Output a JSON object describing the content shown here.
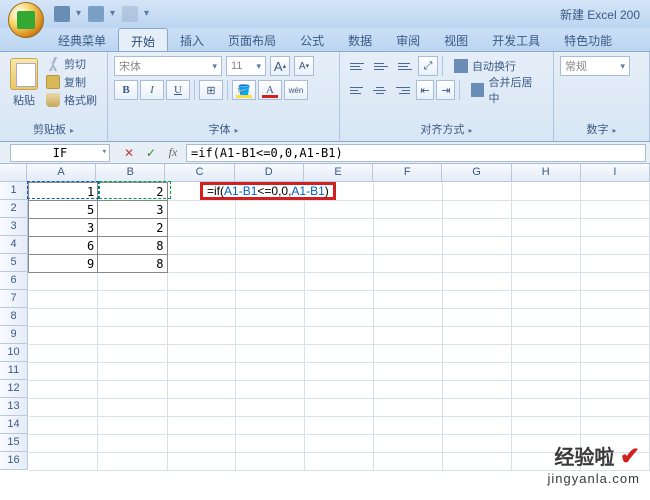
{
  "title": "新建 Excel 200",
  "tabs": [
    "经典菜单",
    "开始",
    "插入",
    "页面布局",
    "公式",
    "数据",
    "审阅",
    "视图",
    "开发工具",
    "特色功能"
  ],
  "active_tab": 1,
  "clipboard": {
    "paste": "粘贴",
    "cut": "剪切",
    "copy": "复制",
    "format": "格式刷",
    "label": "剪贴板"
  },
  "font": {
    "name": "宋体",
    "size": "11",
    "grow": "A",
    "shrink": "A",
    "bold": "B",
    "italic": "I",
    "underline": "U",
    "label": "字体"
  },
  "align": {
    "wrap": "自动换行",
    "merge": "合并后居中",
    "label": "对齐方式"
  },
  "number": {
    "format": "常规",
    "label": "数字"
  },
  "namebox": "IF",
  "formula": "=if(A1-B1<=0,0,A1-B1)",
  "edit_cell": {
    "prefix": "=if(",
    "ref1": "A1-B1",
    "mid": "<=0,0,",
    "ref2": "A1-B1",
    "suffix": ")"
  },
  "columns": [
    "A",
    "B",
    "C",
    "D",
    "E",
    "F",
    "G",
    "H",
    "I"
  ],
  "rows": [
    "1",
    "2",
    "3",
    "4",
    "5",
    "6",
    "7",
    "8",
    "9",
    "10",
    "11",
    "12",
    "13",
    "14",
    "15",
    "16"
  ],
  "data": [
    [
      "1",
      "2"
    ],
    [
      "5",
      "3"
    ],
    [
      "3",
      "2"
    ],
    [
      "6",
      "8"
    ],
    [
      "9",
      "8"
    ]
  ],
  "watermark": {
    "line1": "经验啦",
    "line2": "jingyanla.com"
  }
}
